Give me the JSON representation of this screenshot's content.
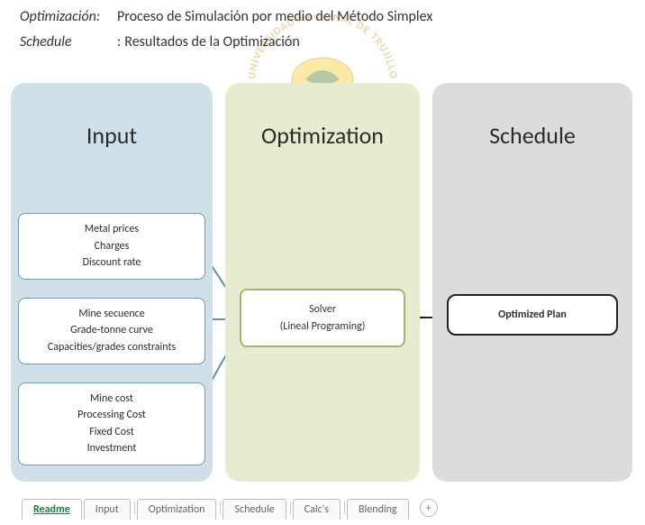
{
  "defs": {
    "opt_term": "Optimización:",
    "opt_val": "Proceso de Simulación por medio del Método Simplex",
    "sch_term": "Schedule",
    "sch_sep": ":",
    "sch_val": "Resultados de la Optimización"
  },
  "watermark": {
    "arc_text": "UNIVERSIDAD NACIONAL DE TRUJILLO"
  },
  "columns": {
    "input": {
      "title": "Input",
      "boxes": [
        [
          "Metal prices",
          "Charges",
          "Discount rate"
        ],
        [
          "Mine secuence",
          "Grade-tonne curve",
          "Capacities/grades constraints"
        ],
        [
          "Mine cost",
          "Processing Cost",
          "Fixed Cost",
          "Investment"
        ]
      ]
    },
    "optimization": {
      "title": "Optimization",
      "solver": [
        "Solver",
        "(Lineal Programing)"
      ]
    },
    "schedule": {
      "title": "Schedule",
      "plan": "Optimized Plan"
    }
  },
  "tabs": {
    "items": [
      "Readme",
      "Input",
      "Optimization",
      "Schedule",
      "Calc's",
      "Blending"
    ],
    "active": 0,
    "add_label": "+"
  }
}
